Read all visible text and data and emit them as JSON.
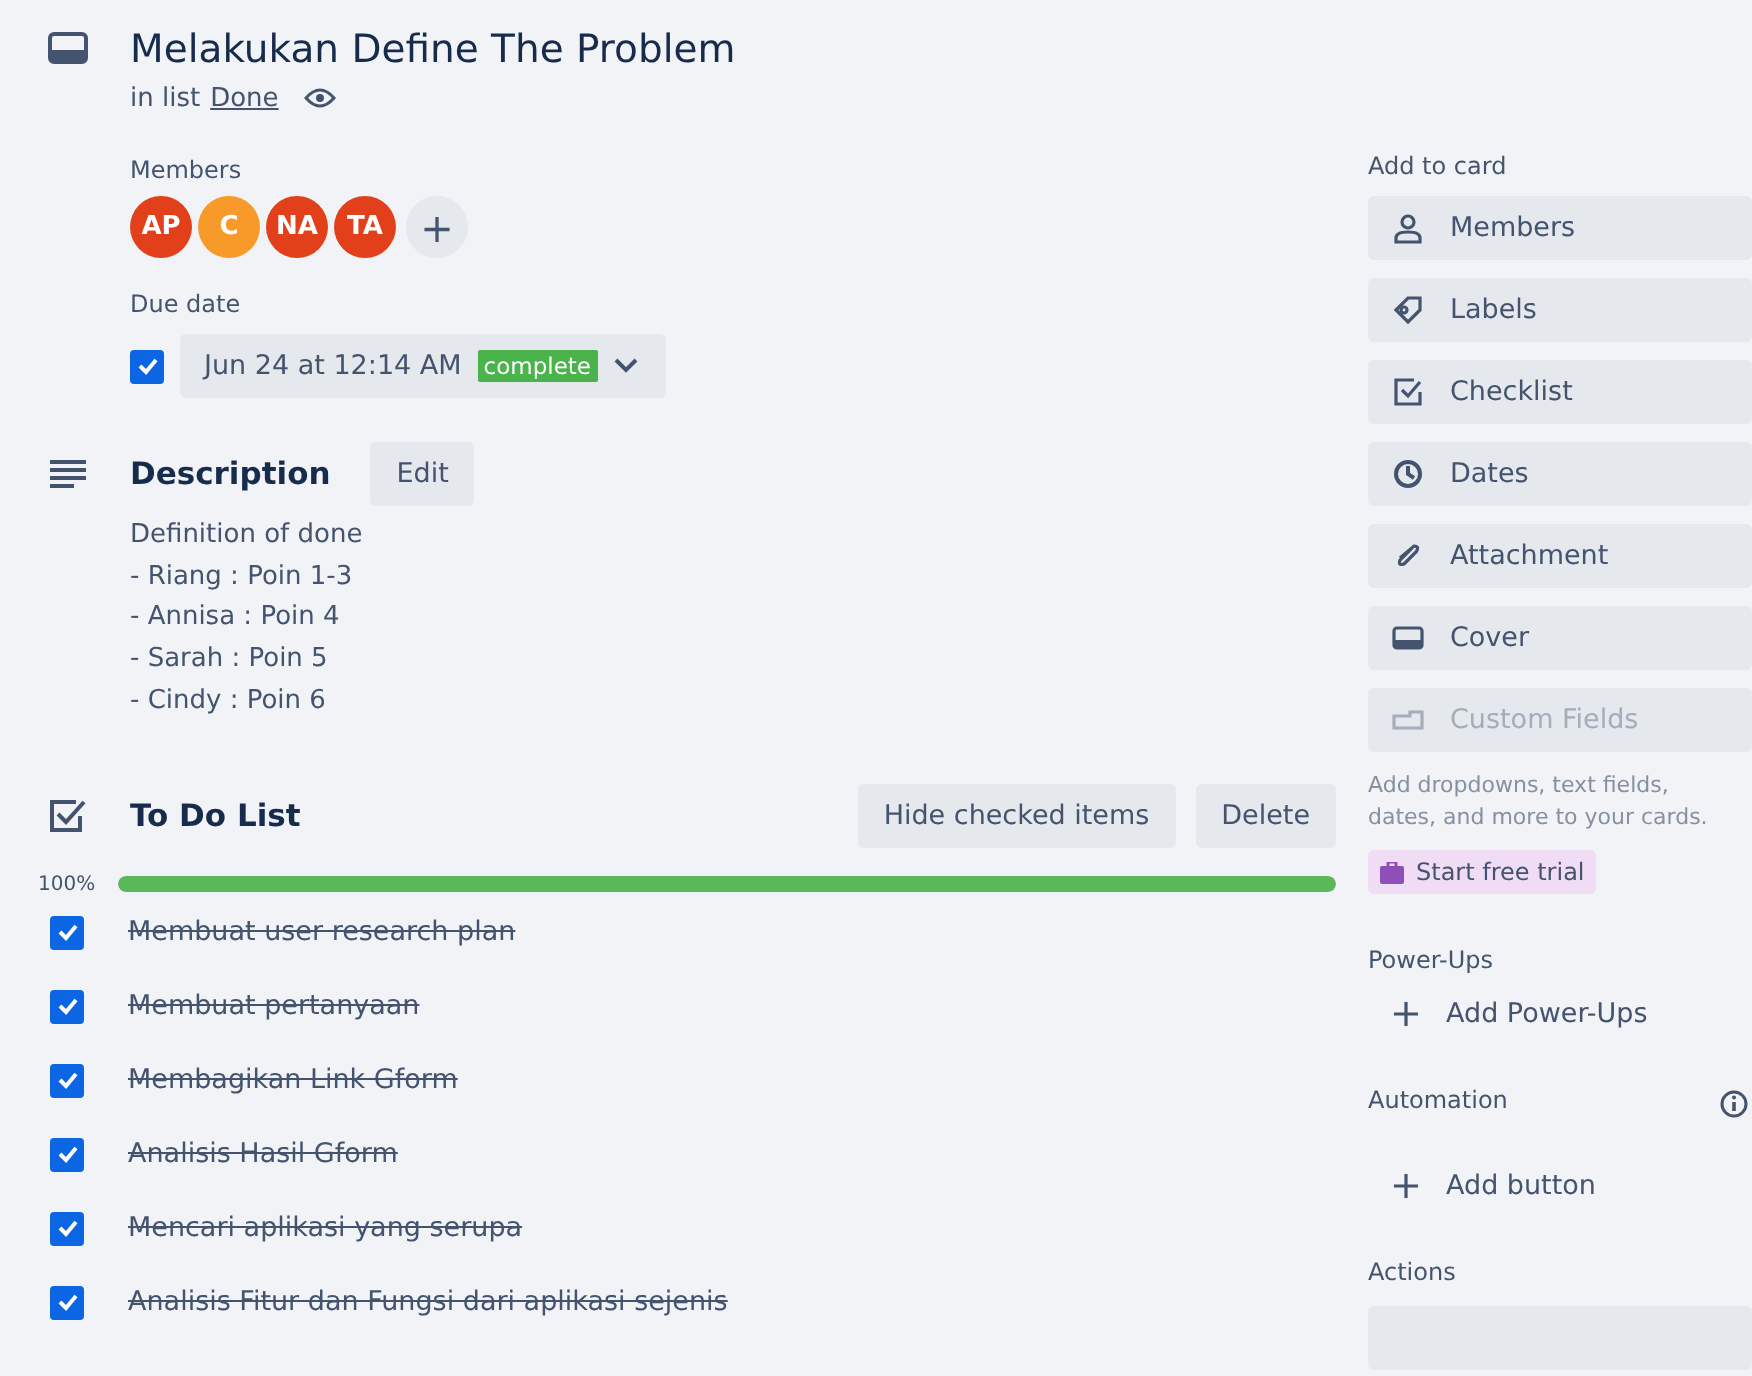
{
  "card": {
    "title": "Melakukan Define The Problem",
    "list_prefix": "in list",
    "list_name": "Done"
  },
  "members": {
    "label": "Members",
    "avatars": [
      {
        "initials": "AP",
        "color": "#e2401b"
      },
      {
        "initials": "C",
        "color": "#f79a2a"
      },
      {
        "initials": "NA",
        "color": "#e2401b"
      },
      {
        "initials": "TA",
        "color": "#e2401b"
      }
    ],
    "add": "+"
  },
  "due_date": {
    "label": "Due date",
    "checked": true,
    "value": "Jun 24 at 12:14 AM",
    "badge": "complete"
  },
  "description": {
    "title": "Description",
    "edit": "Edit",
    "lines": [
      "Definition of done",
      "- Riang : Poin 1-3",
      "- Annisa : Poin 4",
      "- Sarah : Poin 5",
      "- Cindy : Poin 6"
    ]
  },
  "checklist": {
    "title": "To Do List",
    "hide_button": "Hide checked items",
    "delete_button": "Delete",
    "percent": "100%",
    "level": 1,
    "items": [
      {
        "text": "Membuat user research plan",
        "checked": true
      },
      {
        "text": "Membuat pertanyaan",
        "checked": true
      },
      {
        "text": "Membagikan Link Gform",
        "checked": true
      },
      {
        "text": "Analisis Hasil Gform",
        "checked": true
      },
      {
        "text": "Mencari aplikasi yang serupa",
        "checked": true
      },
      {
        "text": "Analisis Fitur dan Fungsi dari aplikasi sejenis",
        "checked": true
      }
    ]
  },
  "sidebar": {
    "add_to_card": "Add to card",
    "buttons": [
      {
        "label": "Members",
        "disabled": false
      },
      {
        "label": "Labels",
        "disabled": false
      },
      {
        "label": "Checklist",
        "disabled": false
      },
      {
        "label": "Dates",
        "disabled": false
      },
      {
        "label": "Attachment",
        "disabled": false
      },
      {
        "label": "Cover",
        "disabled": false
      },
      {
        "label": "Custom Fields",
        "disabled": true
      }
    ],
    "hint": "Add dropdowns, text fields, dates, and more to your cards.",
    "trial": "Start free trial",
    "power_ups": "Power-Ups",
    "add_power_ups": "Add Power-Ups",
    "automation": "Automation",
    "add_button": "Add button",
    "actions": "Actions"
  }
}
